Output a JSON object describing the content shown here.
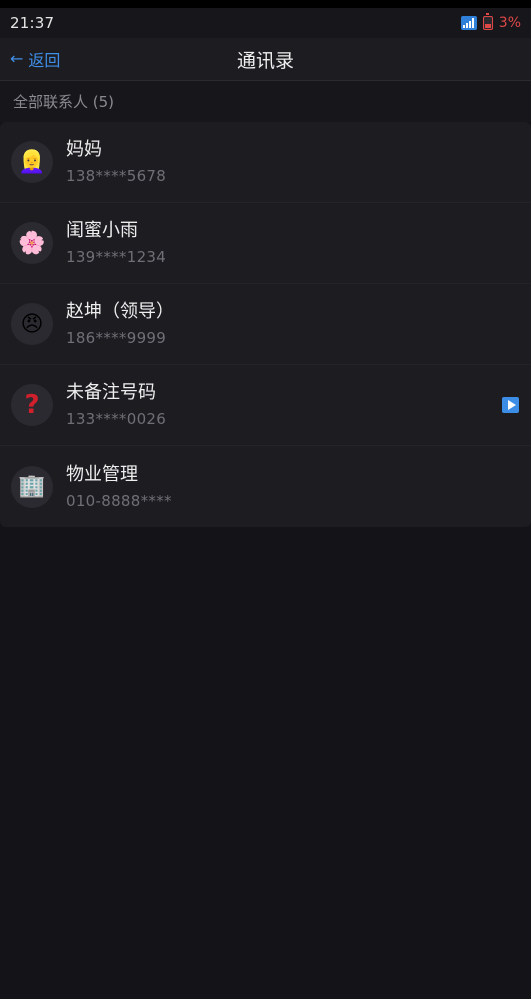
{
  "status_bar": {
    "time": "21:37",
    "battery_percent": "3%",
    "battery_color": "#e04848",
    "signal_icon": "signal-icon",
    "battery_icon": "battery-low-icon"
  },
  "nav": {
    "back_arrow": "←",
    "back_label": "返回",
    "title": "通讯录",
    "accent_color": "#3f8fe8"
  },
  "section": {
    "header": "全部联系人 (5)"
  },
  "contacts": [
    {
      "avatar": "👱‍♀️",
      "avatar_icon": "woman-face-icon",
      "name": "妈妈",
      "phone": "138****5678"
    },
    {
      "avatar": "🌸",
      "avatar_icon": "cherry-blossom-icon",
      "name": "闺蜜小雨",
      "phone": "139****1234"
    },
    {
      "avatar": "😠",
      "avatar_icon": "angry-face-icon",
      "name": "赵坤（领导）",
      "phone": "186****9999"
    },
    {
      "avatar": "?",
      "avatar_icon": "question-mark-icon",
      "name": "未备注号码",
      "phone": "133****0026",
      "trailing_icon": "play-icon"
    },
    {
      "avatar": "🏢",
      "avatar_icon": "office-building-icon",
      "name": "物业管理",
      "phone": "010-8888****"
    }
  ]
}
